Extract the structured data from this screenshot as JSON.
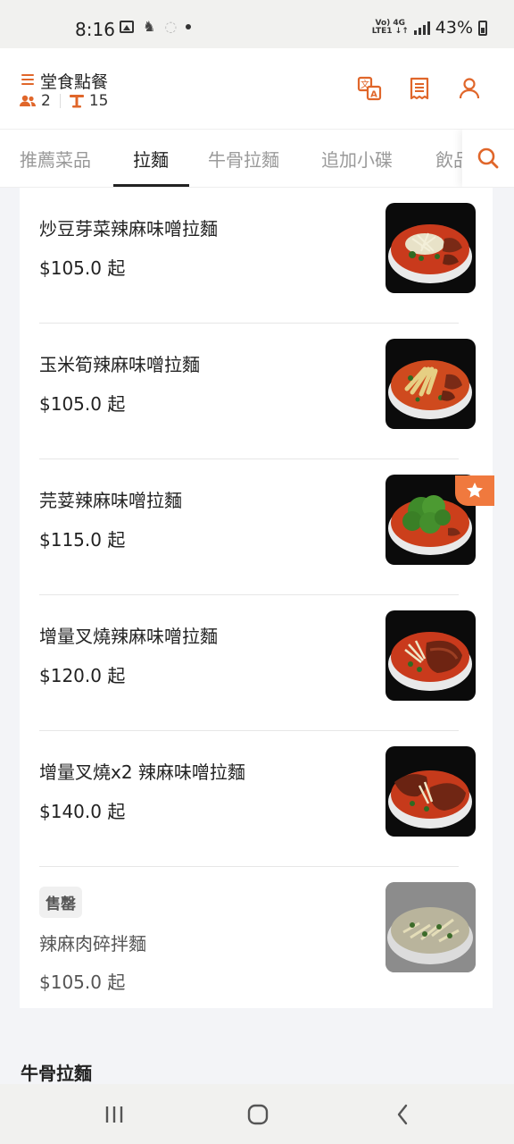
{
  "status_bar": {
    "time": "8:16",
    "network_top": "Vo) 4G",
    "network_bottom": "LTE1 ↓↑",
    "battery_pct": "43%"
  },
  "header": {
    "mode_title": "堂食點餐",
    "guests": "2",
    "table_number": "15",
    "accent_color": "#e0662a",
    "icons": [
      "translate-icon",
      "receipt-icon",
      "user-icon"
    ]
  },
  "tabs": {
    "items": [
      "推薦菜品",
      "拉麵",
      "牛骨拉麵",
      "追加小碟",
      "飲品"
    ],
    "active_index": 1
  },
  "menu": {
    "items": [
      {
        "name": "炒豆芽菜辣麻味噌拉麵",
        "price": "$105.0 起"
      },
      {
        "name": "玉米筍辣麻味噌拉麵",
        "price": "$105.0 起"
      },
      {
        "name": "芫荽辣麻味噌拉麵",
        "price": "$115.0 起",
        "starred": true
      },
      {
        "name": "增量叉燒辣麻味噌拉麵",
        "price": "$120.0 起"
      },
      {
        "name": "增量叉燒x2 辣麻味噌拉麵",
        "price": "$140.0 起"
      },
      {
        "name": "辣麻肉碎拌麵",
        "price": "$105.0 起",
        "badge": "售罄"
      }
    ]
  },
  "next_section_title": "牛骨拉麵"
}
